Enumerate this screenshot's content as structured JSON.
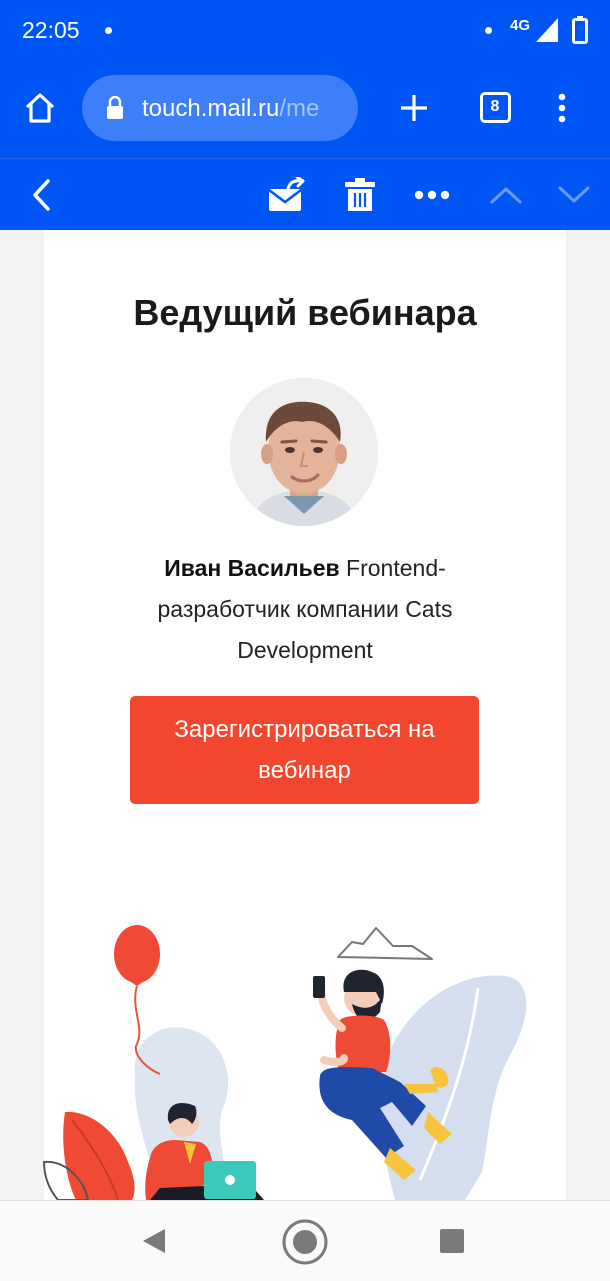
{
  "status_bar": {
    "time": "22:05",
    "network": "4G"
  },
  "browser": {
    "url_main": "touch.mail.ru",
    "url_rest": "/me",
    "tab_count": "8"
  },
  "mail_toolbar": {
    "icons": [
      "back-chevron-icon",
      "move-to-folder-icon",
      "trash-icon",
      "more-icon",
      "prev-message-icon",
      "next-message-icon"
    ]
  },
  "content": {
    "heading": "Ведущий вебинара",
    "speaker_name": "Иван Васильев",
    "speaker_desc": " Frontend-разработчик компании Cats Development",
    "cta_label": "Зарегистрироваться на вебинар"
  },
  "colors": {
    "brand_blue": "#0055f5",
    "cta_red": "#f2462e"
  },
  "system_nav": {
    "icons": [
      "nav-back-icon",
      "nav-home-icon",
      "nav-recents-icon"
    ]
  }
}
